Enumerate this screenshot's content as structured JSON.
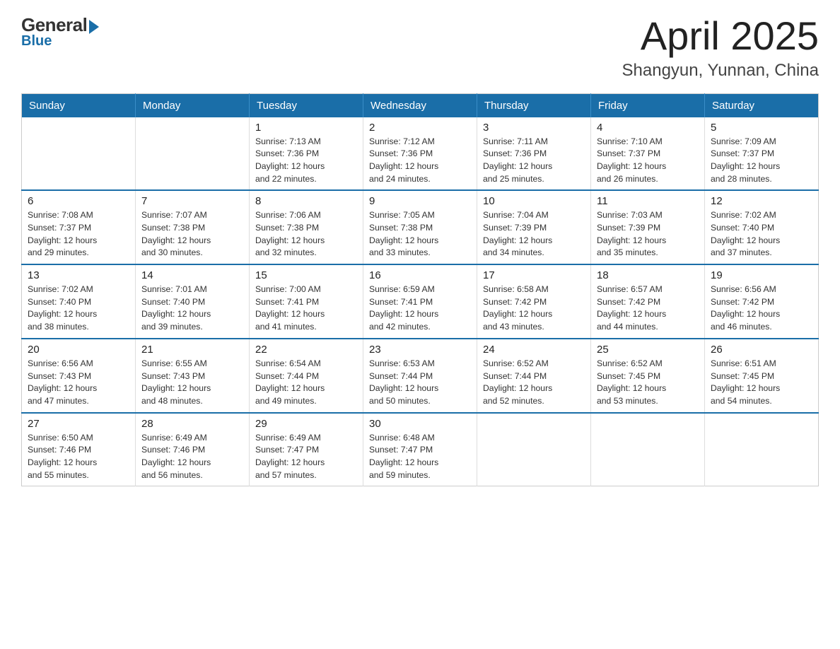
{
  "logo": {
    "general": "General",
    "blue": "Blue"
  },
  "title": "April 2025",
  "subtitle": "Shangyun, Yunnan, China",
  "weekdays": [
    "Sunday",
    "Monday",
    "Tuesday",
    "Wednesday",
    "Thursday",
    "Friday",
    "Saturday"
  ],
  "weeks": [
    [
      {
        "day": "",
        "info": ""
      },
      {
        "day": "",
        "info": ""
      },
      {
        "day": "1",
        "info": "Sunrise: 7:13 AM\nSunset: 7:36 PM\nDaylight: 12 hours\nand 22 minutes."
      },
      {
        "day": "2",
        "info": "Sunrise: 7:12 AM\nSunset: 7:36 PM\nDaylight: 12 hours\nand 24 minutes."
      },
      {
        "day": "3",
        "info": "Sunrise: 7:11 AM\nSunset: 7:36 PM\nDaylight: 12 hours\nand 25 minutes."
      },
      {
        "day": "4",
        "info": "Sunrise: 7:10 AM\nSunset: 7:37 PM\nDaylight: 12 hours\nand 26 minutes."
      },
      {
        "day": "5",
        "info": "Sunrise: 7:09 AM\nSunset: 7:37 PM\nDaylight: 12 hours\nand 28 minutes."
      }
    ],
    [
      {
        "day": "6",
        "info": "Sunrise: 7:08 AM\nSunset: 7:37 PM\nDaylight: 12 hours\nand 29 minutes."
      },
      {
        "day": "7",
        "info": "Sunrise: 7:07 AM\nSunset: 7:38 PM\nDaylight: 12 hours\nand 30 minutes."
      },
      {
        "day": "8",
        "info": "Sunrise: 7:06 AM\nSunset: 7:38 PM\nDaylight: 12 hours\nand 32 minutes."
      },
      {
        "day": "9",
        "info": "Sunrise: 7:05 AM\nSunset: 7:38 PM\nDaylight: 12 hours\nand 33 minutes."
      },
      {
        "day": "10",
        "info": "Sunrise: 7:04 AM\nSunset: 7:39 PM\nDaylight: 12 hours\nand 34 minutes."
      },
      {
        "day": "11",
        "info": "Sunrise: 7:03 AM\nSunset: 7:39 PM\nDaylight: 12 hours\nand 35 minutes."
      },
      {
        "day": "12",
        "info": "Sunrise: 7:02 AM\nSunset: 7:40 PM\nDaylight: 12 hours\nand 37 minutes."
      }
    ],
    [
      {
        "day": "13",
        "info": "Sunrise: 7:02 AM\nSunset: 7:40 PM\nDaylight: 12 hours\nand 38 minutes."
      },
      {
        "day": "14",
        "info": "Sunrise: 7:01 AM\nSunset: 7:40 PM\nDaylight: 12 hours\nand 39 minutes."
      },
      {
        "day": "15",
        "info": "Sunrise: 7:00 AM\nSunset: 7:41 PM\nDaylight: 12 hours\nand 41 minutes."
      },
      {
        "day": "16",
        "info": "Sunrise: 6:59 AM\nSunset: 7:41 PM\nDaylight: 12 hours\nand 42 minutes."
      },
      {
        "day": "17",
        "info": "Sunrise: 6:58 AM\nSunset: 7:42 PM\nDaylight: 12 hours\nand 43 minutes."
      },
      {
        "day": "18",
        "info": "Sunrise: 6:57 AM\nSunset: 7:42 PM\nDaylight: 12 hours\nand 44 minutes."
      },
      {
        "day": "19",
        "info": "Sunrise: 6:56 AM\nSunset: 7:42 PM\nDaylight: 12 hours\nand 46 minutes."
      }
    ],
    [
      {
        "day": "20",
        "info": "Sunrise: 6:56 AM\nSunset: 7:43 PM\nDaylight: 12 hours\nand 47 minutes."
      },
      {
        "day": "21",
        "info": "Sunrise: 6:55 AM\nSunset: 7:43 PM\nDaylight: 12 hours\nand 48 minutes."
      },
      {
        "day": "22",
        "info": "Sunrise: 6:54 AM\nSunset: 7:44 PM\nDaylight: 12 hours\nand 49 minutes."
      },
      {
        "day": "23",
        "info": "Sunrise: 6:53 AM\nSunset: 7:44 PM\nDaylight: 12 hours\nand 50 minutes."
      },
      {
        "day": "24",
        "info": "Sunrise: 6:52 AM\nSunset: 7:44 PM\nDaylight: 12 hours\nand 52 minutes."
      },
      {
        "day": "25",
        "info": "Sunrise: 6:52 AM\nSunset: 7:45 PM\nDaylight: 12 hours\nand 53 minutes."
      },
      {
        "day": "26",
        "info": "Sunrise: 6:51 AM\nSunset: 7:45 PM\nDaylight: 12 hours\nand 54 minutes."
      }
    ],
    [
      {
        "day": "27",
        "info": "Sunrise: 6:50 AM\nSunset: 7:46 PM\nDaylight: 12 hours\nand 55 minutes."
      },
      {
        "day": "28",
        "info": "Sunrise: 6:49 AM\nSunset: 7:46 PM\nDaylight: 12 hours\nand 56 minutes."
      },
      {
        "day": "29",
        "info": "Sunrise: 6:49 AM\nSunset: 7:47 PM\nDaylight: 12 hours\nand 57 minutes."
      },
      {
        "day": "30",
        "info": "Sunrise: 6:48 AM\nSunset: 7:47 PM\nDaylight: 12 hours\nand 59 minutes."
      },
      {
        "day": "",
        "info": ""
      },
      {
        "day": "",
        "info": ""
      },
      {
        "day": "",
        "info": ""
      }
    ]
  ]
}
